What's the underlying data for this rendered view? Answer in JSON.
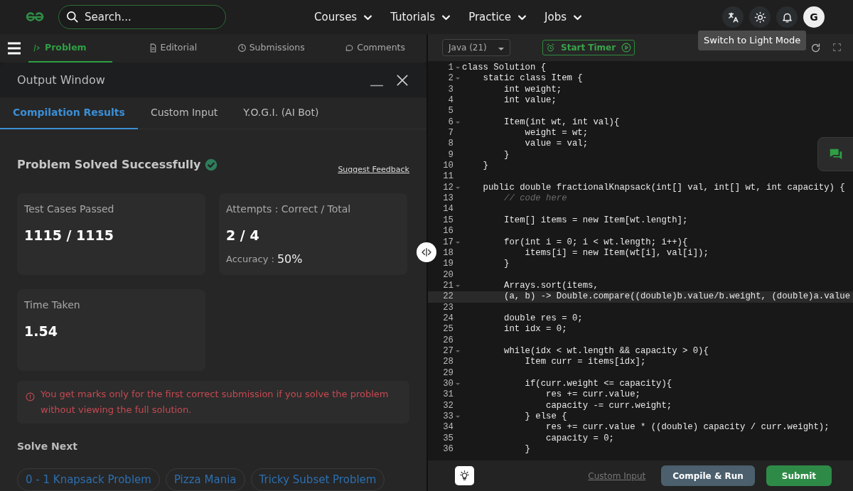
{
  "header": {
    "search": {
      "placeholder": "Search..."
    },
    "nav": [
      {
        "label": "Courses"
      },
      {
        "label": "Tutorials"
      },
      {
        "label": "Practice"
      },
      {
        "label": "Jobs"
      }
    ],
    "avatar": "G",
    "tooltip": "Switch to Light Mode"
  },
  "problem_tabs": [
    {
      "label": "Problem",
      "kind": "problem",
      "selected": true
    },
    {
      "label": "Editorial",
      "kind": "editorial",
      "selected": false
    },
    {
      "label": "Submissions",
      "kind": "submissions",
      "selected": false
    },
    {
      "label": "Comments",
      "kind": "comments",
      "selected": false
    }
  ],
  "output_window": {
    "title": "Output Window",
    "tabs": [
      {
        "label": "Compilation Results",
        "selected": true
      },
      {
        "label": "Custom Input",
        "selected": false
      },
      {
        "label": "Y.O.G.I. (AI Bot)",
        "selected": false
      }
    ],
    "status": "Problem Solved Successfully",
    "feedback_link": "Suggest Feedback",
    "stats": [
      {
        "label": "Test Cases Passed",
        "value": "1115 / 1115"
      },
      {
        "label": "Attempts : Correct / Total",
        "value": "2 / 4",
        "sub_label": "Accuracy :",
        "sub_value": "50%"
      },
      {
        "label": "Time Taken",
        "value": "1.54"
      }
    ],
    "notice": "You get marks only for the first correct submission if you solve the problem without viewing the full solution.",
    "solve_next": {
      "title": "Solve Next",
      "problems": [
        "0 - 1 Knapsack Problem",
        "Pizza Mania",
        "Tricky Subset Problem"
      ]
    }
  },
  "editor": {
    "language": "Java (21)",
    "timer_button": "Start Timer",
    "lines": [
      {
        "number": "1",
        "text": "class Solution {",
        "fold": true,
        "active": false
      },
      {
        "number": "2",
        "text": "    static class Item {",
        "fold": true,
        "active": false
      },
      {
        "number": "3",
        "text": "        int weight;",
        "fold": false,
        "active": false
      },
      {
        "number": "4",
        "text": "        int value;",
        "fold": false,
        "active": false
      },
      {
        "number": "5",
        "fold": false,
        "active": false
      },
      {
        "number": "6",
        "text": "        Item(int wt, int val){",
        "fold": true,
        "active": false
      },
      {
        "number": "7",
        "text": "            weight = wt;",
        "fold": false,
        "active": false
      },
      {
        "number": "8",
        "text": "            value = val;",
        "fold": false,
        "active": false
      },
      {
        "number": "9",
        "text": "        }",
        "fold": false,
        "active": false
      },
      {
        "number": "10",
        "text": "    }",
        "fold": false,
        "active": false
      },
      {
        "number": "11",
        "fold": false,
        "active": false
      },
      {
        "number": "12",
        "text": "    public double fractionalKnapsack(int[] val, int[] wt, int capacity) {",
        "fold": true,
        "active": false
      },
      {
        "number": "13",
        "text": "        // code here",
        "kind": "comment",
        "fold": false,
        "active": false
      },
      {
        "number": "14",
        "fold": false,
        "active": false
      },
      {
        "number": "15",
        "text": "        Item[] items = new Item[wt.length];",
        "fold": false,
        "active": false
      },
      {
        "number": "16",
        "fold": false,
        "active": false
      },
      {
        "number": "17",
        "text": "        for(int i = 0; i < wt.length; i++){",
        "fold": true,
        "active": false
      },
      {
        "number": "18",
        "text": "            items[i] = new Item(wt[i], val[i]);",
        "fold": false,
        "active": false
      },
      {
        "number": "19",
        "text": "        }",
        "fold": false,
        "active": false
      },
      {
        "number": "20",
        "fold": false,
        "active": false
      },
      {
        "number": "21",
        "text": "        Arrays.sort(items,",
        "fold": true,
        "active": false
      },
      {
        "number": "22",
        "text": "        (a, b) -> Double.compare((double)b.value/b.weight, (double)a.value",
        "fold": false,
        "active": true
      },
      {
        "number": "23",
        "fold": false,
        "active": false
      },
      {
        "number": "24",
        "text": "        double res = 0;",
        "fold": false,
        "active": false
      },
      {
        "number": "25",
        "text": "        int idx = 0;",
        "fold": false,
        "active": false
      },
      {
        "number": "26",
        "fold": false,
        "active": false
      },
      {
        "number": "27",
        "text": "        while(idx < wt.length && capacity > 0){",
        "fold": true,
        "active": false
      },
      {
        "number": "28",
        "text": "            Item curr = items[idx];",
        "fold": false,
        "active": false
      },
      {
        "number": "29",
        "fold": false,
        "active": false
      },
      {
        "number": "30",
        "text": "            if(curr.weight <= capacity){",
        "fold": true,
        "active": false
      },
      {
        "number": "31",
        "text": "                res += curr.value;",
        "fold": false,
        "active": false
      },
      {
        "number": "32",
        "text": "                capacity -= curr.weight;",
        "fold": false,
        "active": false
      },
      {
        "number": "33",
        "text": "            } else {",
        "fold": true,
        "active": false
      },
      {
        "number": "34",
        "text": "                res += curr.value * ((double) capacity / curr.weight);",
        "fold": false,
        "active": false
      },
      {
        "number": "35",
        "text": "                capacity = 0;",
        "fold": false,
        "active": false
      },
      {
        "number": "36",
        "text": "            }",
        "fold": false,
        "active": false
      }
    ]
  },
  "footer": {
    "custom_input": "Custom Input",
    "buttons": [
      {
        "label": "Compile & Run",
        "kind": "secondary"
      },
      {
        "label": "Submit",
        "kind": "primary"
      }
    ]
  }
}
